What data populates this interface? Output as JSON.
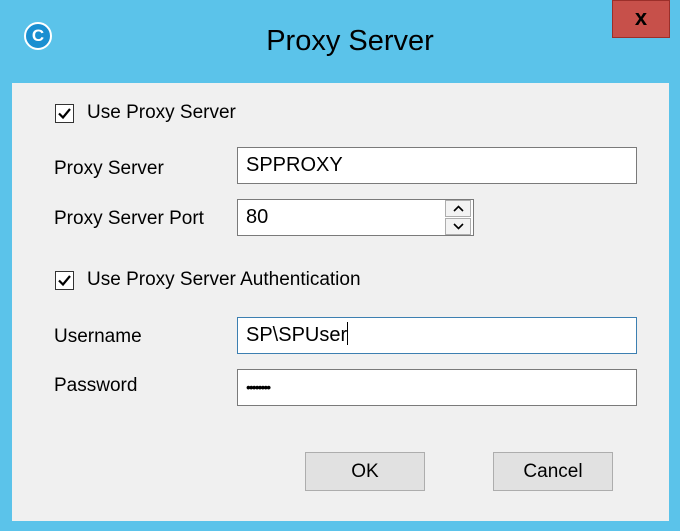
{
  "window": {
    "title": "Proxy Server",
    "app_icon_letter": "C",
    "close_glyph": "x"
  },
  "use_proxy": {
    "label": "Use Proxy Server",
    "checked": true
  },
  "proxy_server": {
    "label": "Proxy Server",
    "value": "SPPROXY"
  },
  "proxy_port": {
    "label": "Proxy Server Port",
    "value": "80"
  },
  "use_auth": {
    "label": "Use Proxy Server Authentication",
    "checked": true
  },
  "username": {
    "label": "Username",
    "value": "SP\\SPUser"
  },
  "password": {
    "label": "Password",
    "value": "••••••••"
  },
  "buttons": {
    "ok": "OK",
    "cancel": "Cancel"
  },
  "icons": {
    "app": "c-logo-icon",
    "close": "close-icon",
    "check": "checkmark-icon",
    "spin_up": "chevron-up-icon",
    "spin_down": "chevron-down-icon"
  },
  "colors": {
    "titlebar": "#5bc3ea",
    "close": "#c7504a",
    "client": "#f0f0f0"
  }
}
